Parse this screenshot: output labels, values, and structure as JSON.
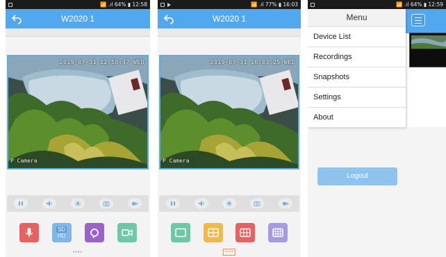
{
  "screens": [
    {
      "status": {
        "right": "📶 .ıl 64% ▮ 12:58"
      },
      "title": "W2020 1",
      "video": {
        "timestamp": "2019-07-31 12:58:47 WED",
        "camera_name": "P Camera"
      },
      "controls": [
        "pause-icon",
        "volume-icon",
        "brightness-icon",
        "snapshot-icon",
        "record-icon"
      ],
      "tiles": [
        {
          "icon": "microphone-icon",
          "color": "#e86060"
        },
        {
          "icon": "sd-hd-icon",
          "color": "#7fb8e8",
          "label_top": "SD",
          "label_bottom": "HD"
        },
        {
          "icon": "refresh-icon",
          "color": "#9b63c9"
        },
        {
          "icon": "video-camera-icon",
          "color": "#6ec7a7"
        }
      ],
      "pager": "••••"
    },
    {
      "status": {
        "right": "📶 .ıl 77% ▮ 16:03"
      },
      "title": "W2020 1",
      "video": {
        "timestamp": "2019-07-31 16:03:25 WED",
        "camera_name": "P Camera"
      },
      "controls": [
        "pause-icon",
        "volume-icon",
        "brightness-icon",
        "snapshot-icon",
        "record-icon"
      ],
      "tiles": [
        {
          "icon": "single-view-icon",
          "color": "#6ec7a7"
        },
        {
          "icon": "dual-view-icon",
          "color": "#f0b94a"
        },
        {
          "icon": "quad-view-icon",
          "color": "#e86060"
        },
        {
          "icon": "nine-view-icon",
          "color": "#a79be0"
        }
      ],
      "pager": "••••"
    },
    {
      "status": {
        "right": "📶 .ıl 64% ▮ 12:59"
      },
      "menu": {
        "title": "Menu",
        "items": [
          "Device List",
          "Recordings",
          "Snapshots",
          "Settings",
          "About"
        ]
      },
      "logout_label": "Logout"
    }
  ],
  "colors": {
    "accent": "#52a8ee",
    "video_border": "#5aaee8",
    "logout": "#8fc3ee"
  }
}
